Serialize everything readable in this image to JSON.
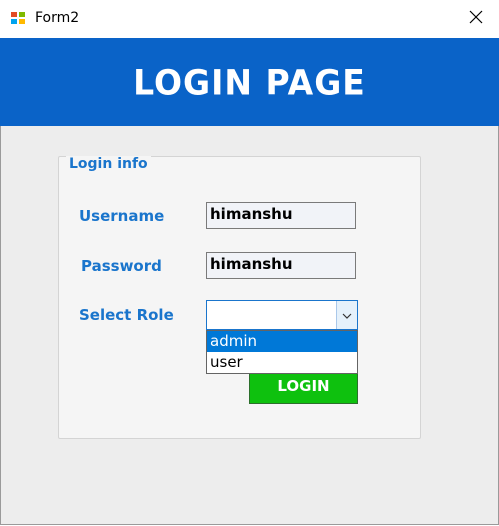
{
  "window": {
    "title": "Form2",
    "close_glyph": "✕"
  },
  "icons": {
    "app": "windows-form-icon",
    "close": "close-icon",
    "dropdown": "chevron-down-icon"
  },
  "header": {
    "title": "LOGIN PAGE"
  },
  "group": {
    "title": "Login info"
  },
  "form": {
    "username_label": "Username",
    "username_value": "himanshu",
    "password_label": "Password",
    "password_value": "himanshu",
    "role_label": "Select Role",
    "role_value": "",
    "role_options": [
      "admin",
      "user"
    ],
    "highlighted_option": "admin"
  },
  "buttons": {
    "login": "LOGIN"
  },
  "colors": {
    "header": "#0a63c8",
    "label": "#1a75cc",
    "button": "#0ec10e",
    "selection": "#0078d7"
  }
}
